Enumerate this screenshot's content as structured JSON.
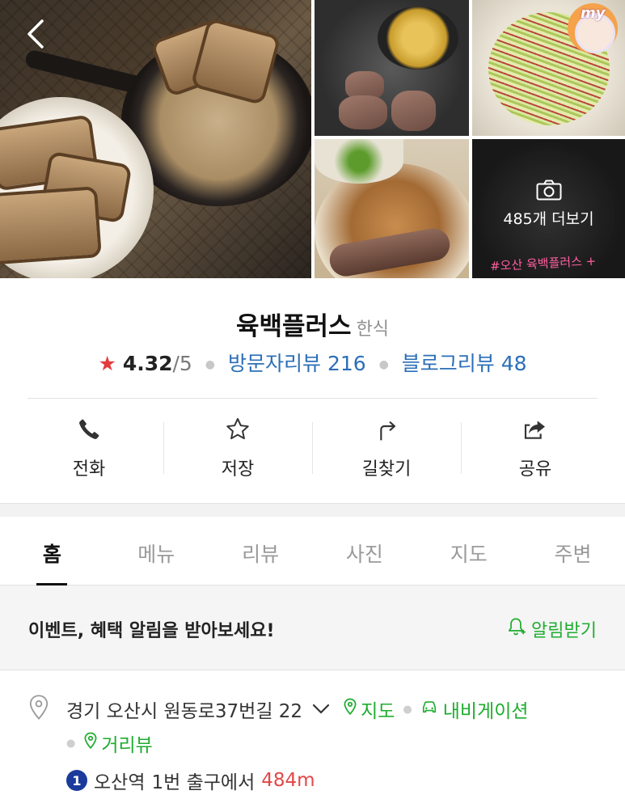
{
  "photos": {
    "more_label": "485개 더보기",
    "watermark": "#오산 육백플러스 +",
    "badge_text": "my"
  },
  "place": {
    "name": "육백플러스",
    "category": "한식",
    "rating": "4.32",
    "rating_max": "/5",
    "visitor_reviews_label": "방문자리뷰",
    "visitor_reviews_count": "216",
    "blog_reviews_label": "블로그리뷰",
    "blog_reviews_count": "48"
  },
  "actions": [
    {
      "label": "전화",
      "icon": "phone-icon"
    },
    {
      "label": "저장",
      "icon": "star-outline-icon"
    },
    {
      "label": "길찾기",
      "icon": "directions-icon"
    },
    {
      "label": "공유",
      "icon": "share-icon"
    }
  ],
  "tabs": [
    {
      "label": "홈",
      "active": true
    },
    {
      "label": "메뉴"
    },
    {
      "label": "리뷰"
    },
    {
      "label": "사진"
    },
    {
      "label": "지도"
    },
    {
      "label": "주변"
    }
  ],
  "banner": {
    "text": "이벤트, 혜택 알림을 받아보세요!",
    "action": "알림받기"
  },
  "address": {
    "text": "경기 오산시 원동로37번길 22",
    "map_link": "지도",
    "nav_link": "내비게이션",
    "street_view_link": "거리뷰",
    "subway_line": "1",
    "station": "오산역",
    "exit": "1번 출구에서",
    "distance": "484m"
  },
  "colors": {
    "accent_green": "#1fad2f",
    "link_blue": "#2c6fb7",
    "star_red": "#e23c3c",
    "distance_red": "#e24848",
    "subway_line1": "#1a3b9c"
  }
}
